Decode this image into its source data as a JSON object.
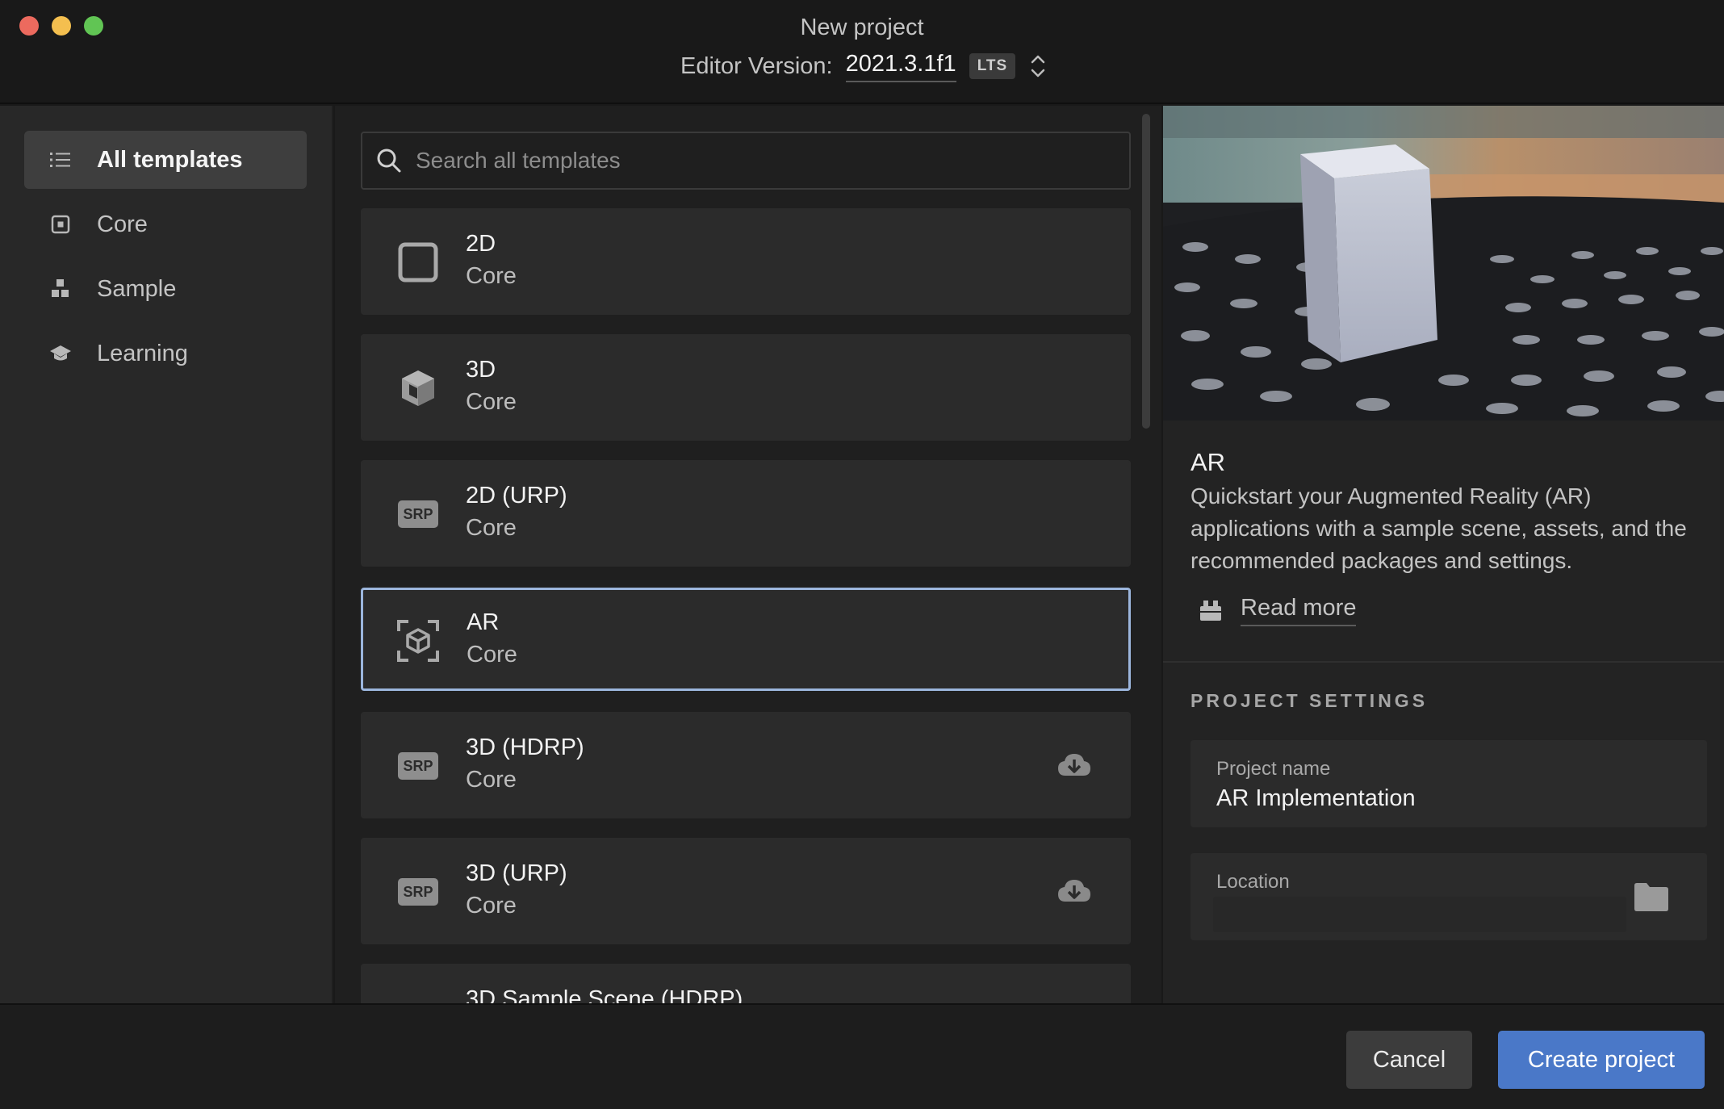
{
  "window": {
    "title": "New project",
    "version_label": "Editor Version:",
    "version_value": "2021.3.1f1",
    "version_badge": "LTS"
  },
  "sidebar": {
    "items": [
      {
        "label": "All templates",
        "icon": "list-icon",
        "active": true
      },
      {
        "label": "Core",
        "icon": "core-icon",
        "active": false
      },
      {
        "label": "Sample",
        "icon": "sample-icon",
        "active": false
      },
      {
        "label": "Learning",
        "icon": "learning-icon",
        "active": false
      }
    ]
  },
  "search": {
    "placeholder": "Search all templates"
  },
  "templates": [
    {
      "name": "2D",
      "category": "Core",
      "icon": "square-icon",
      "download": false,
      "selected": false
    },
    {
      "name": "3D",
      "category": "Core",
      "icon": "cube-icon",
      "download": false,
      "selected": false
    },
    {
      "name": "2D (URP)",
      "category": "Core",
      "icon": "srp-badge-icon",
      "badge_text": "SRP",
      "download": false,
      "selected": false
    },
    {
      "name": "AR",
      "category": "Core",
      "icon": "ar-cube-icon",
      "download": false,
      "selected": true
    },
    {
      "name": "3D (HDRP)",
      "category": "Core",
      "icon": "srp-badge-icon",
      "badge_text": "SRP",
      "download": true,
      "selected": false
    },
    {
      "name": "3D (URP)",
      "category": "Core",
      "icon": "srp-badge-icon",
      "badge_text": "SRP",
      "download": true,
      "selected": false
    },
    {
      "name": "3D Sample Scene (HDRP)",
      "category": "",
      "icon": "",
      "download": false,
      "selected": false
    }
  ],
  "detail": {
    "title": "AR",
    "description": "Quickstart your Augmented Reality (AR) applications with a sample scene, assets, and the recommended packages and settings.",
    "read_more": "Read more",
    "settings_heading": "PROJECT SETTINGS",
    "project_name_label": "Project name",
    "project_name_value": "AR Implementation",
    "location_label": "Location",
    "location_value": ""
  },
  "footer": {
    "cancel_label": "Cancel",
    "create_label": "Create project"
  },
  "colors": {
    "accent": "#4a78c8",
    "selection_border": "#9cb6dd",
    "background": "#191919"
  }
}
